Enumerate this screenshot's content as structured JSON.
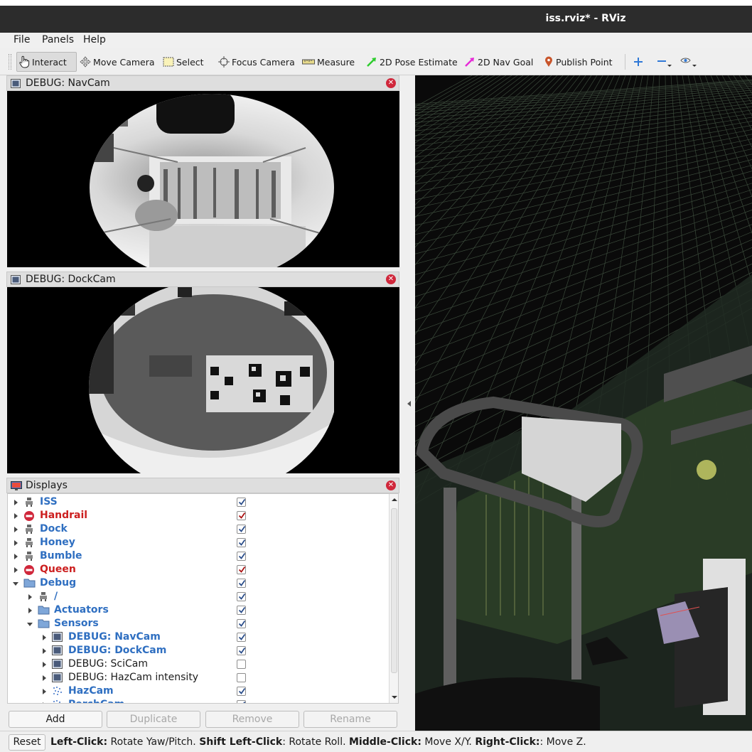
{
  "window": {
    "title": "iss.rviz* - RViz"
  },
  "menu": [
    "File",
    "Panels",
    "Help"
  ],
  "toolbar": {
    "interact": "Interact",
    "move_camera": "Move Camera",
    "select": "Select",
    "focus_camera": "Focus Camera",
    "measure": "Measure",
    "pose_estimate": "2D Pose Estimate",
    "nav_goal": "2D Nav Goal",
    "publish_point": "Publish Point"
  },
  "panels": {
    "navcam": {
      "title": "DEBUG: NavCam"
    },
    "dockcam": {
      "title": "DEBUG: DockCam"
    },
    "displays": {
      "title": "Displays"
    }
  },
  "displays": [
    {
      "label": "ISS",
      "level": 0,
      "expanded": false,
      "icon": "robot-model-icon",
      "style": "blue",
      "checked": true
    },
    {
      "label": "Handrail",
      "level": 0,
      "expanded": false,
      "icon": "error-icon",
      "style": "red",
      "checked": true
    },
    {
      "label": "Dock",
      "level": 0,
      "expanded": false,
      "icon": "robot-model-icon",
      "style": "blue",
      "checked": true
    },
    {
      "label": "Honey",
      "level": 0,
      "expanded": false,
      "icon": "robot-model-icon",
      "style": "blue",
      "checked": true
    },
    {
      "label": "Bumble",
      "level": 0,
      "expanded": false,
      "icon": "robot-model-icon",
      "style": "blue",
      "checked": true
    },
    {
      "label": "Queen",
      "level": 0,
      "expanded": false,
      "icon": "error-icon",
      "style": "red",
      "checked": true
    },
    {
      "label": "Debug",
      "level": 0,
      "expanded": true,
      "icon": "folder-icon",
      "style": "blue",
      "checked": true
    },
    {
      "label": "/",
      "level": 1,
      "expanded": false,
      "icon": "robot-model-icon",
      "style": "blue",
      "checked": true
    },
    {
      "label": "Actuators",
      "level": 1,
      "expanded": false,
      "icon": "folder-icon",
      "style": "blue",
      "checked": true
    },
    {
      "label": "Sensors",
      "level": 1,
      "expanded": true,
      "icon": "folder-icon",
      "style": "blue",
      "checked": true
    },
    {
      "label": "DEBUG: NavCam",
      "level": 2,
      "expanded": false,
      "icon": "image-icon",
      "style": "blue",
      "checked": true
    },
    {
      "label": "DEBUG: DockCam",
      "level": 2,
      "expanded": false,
      "icon": "image-icon",
      "style": "blue",
      "checked": true
    },
    {
      "label": "DEBUG: SciCam",
      "level": 2,
      "expanded": false,
      "icon": "image-icon",
      "style": "plain",
      "checked": false
    },
    {
      "label": "DEBUG: HazCam intensity",
      "level": 2,
      "expanded": false,
      "icon": "image-icon",
      "style": "plain",
      "checked": false
    },
    {
      "label": "HazCam",
      "level": 2,
      "expanded": false,
      "icon": "pointcloud-icon",
      "style": "blue",
      "checked": true
    },
    {
      "label": "PerchCam",
      "level": 2,
      "expanded": false,
      "icon": "pointcloud-icon",
      "style": "blue",
      "checked": true
    }
  ],
  "buttons": {
    "add": "Add",
    "duplicate": "Duplicate",
    "remove": "Remove",
    "rename": "Rename"
  },
  "status": {
    "reset": "Reset",
    "parts": [
      {
        "b": "Left-Click:",
        "t": " Rotate Yaw/Pitch. "
      },
      {
        "b": "Shift Left-Click",
        "t": ": Rotate Roll. "
      },
      {
        "b": "Middle-Click:",
        "t": " Move X/Y. "
      },
      {
        "b": "Right-Click:",
        "t": ": Move Z."
      }
    ]
  },
  "colors": {
    "titlebar": "#2c2c2c",
    "blue_label": "#2f6fc1",
    "red_label": "#cc1f1f",
    "grid": "#3b4a3b"
  }
}
